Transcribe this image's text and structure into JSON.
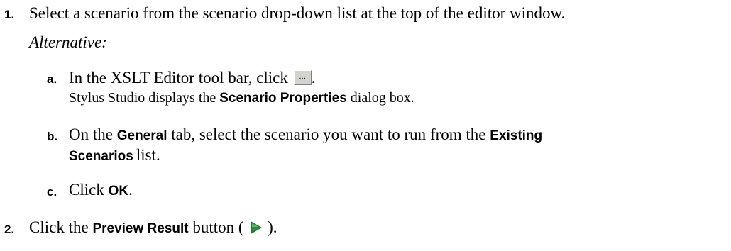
{
  "steps": [
    {
      "number": "1.",
      "text": "Select a scenario from the scenario drop-down list at the top of the editor window.",
      "alternative_label": "Alternative:",
      "substeps": [
        {
          "letter": "a.",
          "text_before": "In the XSLT Editor tool bar, click",
          "text_after": ".",
          "button_glyph": "...",
          "result_before": "Stylus Studio displays the",
          "result_bold": "Scenario Properties",
          "result_after": "dialog box."
        },
        {
          "letter": "b.",
          "part1": "On the",
          "bold1": "General",
          "part2": "tab, select the scenario you want to run from the",
          "bold2a": "Existing",
          "bold2b": "Scenarios",
          "part3": "list."
        },
        {
          "letter": "c.",
          "part1": "Click",
          "bold1": "OK",
          "part2": "."
        }
      ]
    },
    {
      "number": "2.",
      "part1": "Click the",
      "bold1": "Preview Result",
      "part2": "button (",
      "part3": ")."
    }
  ],
  "icons": {
    "scenario_button": "ellipsis-button-icon",
    "preview": "preview-play-icon"
  },
  "colors": {
    "preview_icon_fill": "#2e8b3e",
    "button_face": "#d6d3ce"
  }
}
